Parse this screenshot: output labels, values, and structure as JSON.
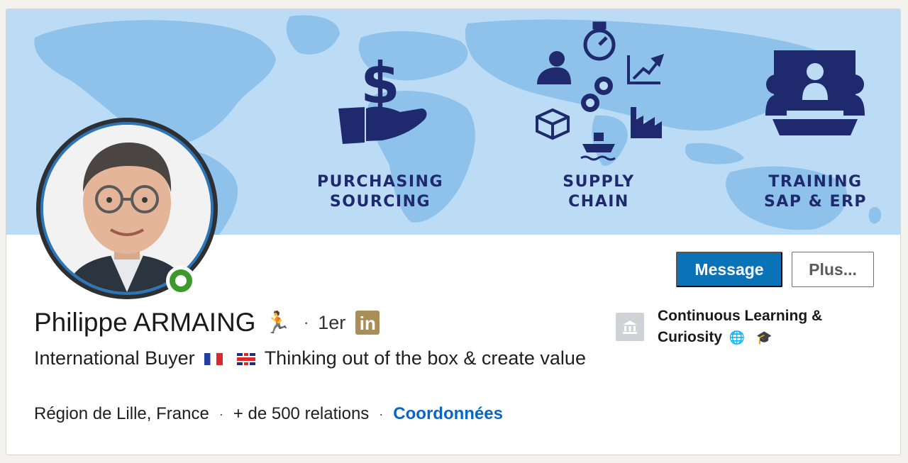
{
  "banner": {
    "sections": [
      {
        "line1": "PURCHASING",
        "line2": "SOURCING"
      },
      {
        "line1": "SUPPLY",
        "line2": "CHAIN"
      },
      {
        "line1": "TRAINING",
        "line2": "SAP & ERP"
      }
    ],
    "colors": {
      "background": "#bcdcf5",
      "map": "#8ec2ea",
      "icons": "#1f2a6e"
    }
  },
  "profile": {
    "name": "Philippe ARMAING",
    "name_emoji": "🏃",
    "separator": "·",
    "degree": "1er",
    "badge": "in",
    "headline_part1": "International Buyer",
    "headline_part2": "Thinking out of the box & create value",
    "location": "Région de Lille, France",
    "connections": "+ de 500 relations",
    "contact_link": "Coordonnées",
    "online_status": "online"
  },
  "actions": {
    "message_label": "Message",
    "more_label": "Plus..."
  },
  "education": {
    "name": "Continuous Learning & Curiosity",
    "icons": [
      "globe-icon",
      "graduation-cap-icon"
    ],
    "globe": "🌐",
    "cap": "🎓"
  }
}
